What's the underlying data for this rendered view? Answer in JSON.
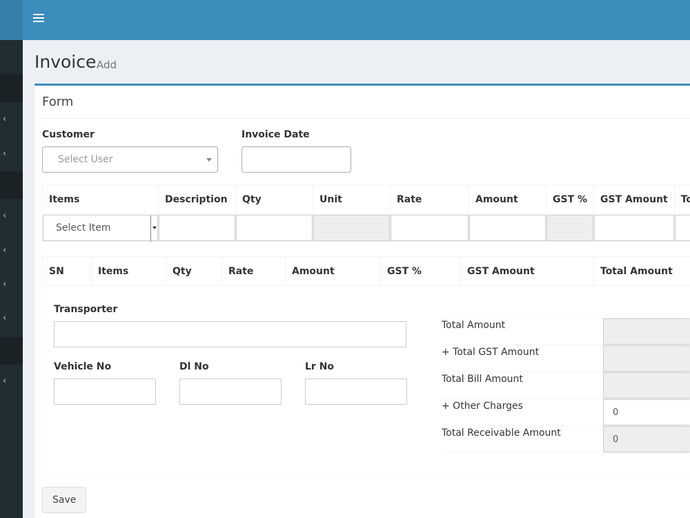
{
  "header": {
    "menu_icon": "hamburger-icon"
  },
  "sidebar": {
    "items": [
      {
        "icon": "chevron-left-icon",
        "has_chevron": false
      },
      {
        "icon": "chevron-left-icon",
        "has_chevron": true
      },
      {
        "icon": "chevron-left-icon",
        "has_chevron": true
      },
      {
        "icon": "chevron-left-icon",
        "has_chevron": true
      },
      {
        "icon": "chevron-left-icon",
        "has_chevron": true
      },
      {
        "icon": "chevron-left-icon",
        "has_chevron": true
      },
      {
        "icon": "chevron-left-icon",
        "has_chevron": true
      },
      {
        "icon": "chevron-left-icon",
        "has_chevron": true
      }
    ]
  },
  "page": {
    "title": "Invoice",
    "subtitle": "Add"
  },
  "form": {
    "box_title": "Form",
    "customer_label": "Customer",
    "customer_placeholder": "Select User",
    "invoice_date_label": "Invoice Date",
    "invoice_date_value": "",
    "item_table": {
      "headers": [
        "Items",
        "Description",
        "Qty",
        "Unit",
        "Rate",
        "Amount",
        "GST %",
        "GST Amount",
        "Tot"
      ],
      "item_select": "Select Item"
    },
    "list_table": {
      "headers": [
        "SN",
        "Items",
        "Qty",
        "Rate",
        "Amount",
        "GST %",
        "GST Amount",
        "Total Amount"
      ]
    },
    "transporter_label": "Transporter",
    "vehicle_label": "Vehicle No",
    "dl_label": "Dl No",
    "lr_label": "Lr No",
    "summary": [
      {
        "label": "Total Amount",
        "value": "",
        "readonly": true
      },
      {
        "label": "+ Total GST Amount",
        "value": "",
        "readonly": true
      },
      {
        "label": "Total Bill Amount",
        "value": "",
        "readonly": true
      },
      {
        "label": "+ Other Charges",
        "value": "0",
        "readonly": false
      },
      {
        "label": "Total Receivable Amount",
        "value": "0",
        "readonly": true
      }
    ],
    "save_label": "Save"
  },
  "colors": {
    "header": "#3c8dbc",
    "sidebar": "#222d32",
    "accent": "#3c8dbc"
  }
}
